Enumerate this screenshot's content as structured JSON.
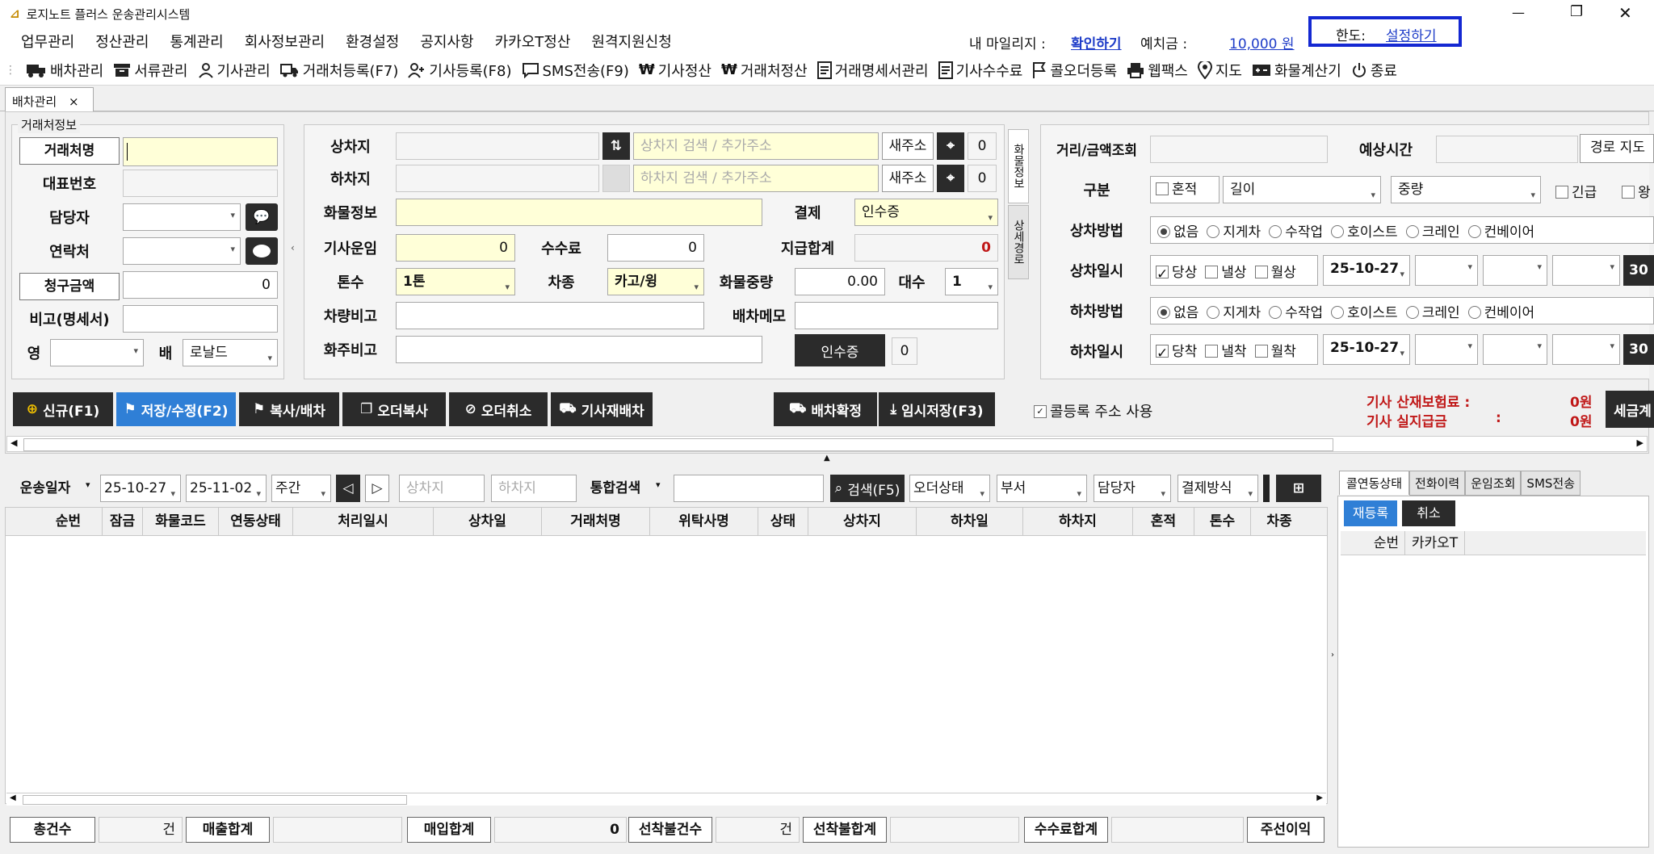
{
  "window": {
    "title": "로지노트 플러스 운송관리시스템",
    "min": "—",
    "max": "❐",
    "close": "✕"
  },
  "menu": [
    "업무관리",
    "정산관리",
    "통계관리",
    "회사정보관리",
    "환경설정",
    "공지사항",
    "카카오T정산",
    "원격지원신청"
  ],
  "header": {
    "mileage_label": "내 마일리지 :",
    "mileage_link": "확인하기",
    "deposit_label": "예치금 :",
    "deposit_value": "10,000 원",
    "limit_label": "한도:",
    "limit_link": "설정하기"
  },
  "toolbar": [
    "배차관리",
    "서류관리",
    "기사관리",
    "거래처등록(F7)",
    "기사등록(F8)",
    "SMS전송(F9)",
    "기사정산",
    "거래처정산",
    "거래명세서관리",
    "기사수수료",
    "콜오더등록",
    "웹팩스",
    "지도",
    "화물계산기",
    "종료"
  ],
  "tab": {
    "label": "배차관리",
    "close": "×"
  },
  "client": {
    "group": "거래처정보",
    "name_btn": "거래처명",
    "repr": "대표번호",
    "manager": "담당자",
    "contact": "연락처",
    "bill_btn": "청구금액",
    "bill_value": "0",
    "memo": "비고(명세서)",
    "young": "영",
    "bae": "배",
    "bae_value": "로날드"
  },
  "route": {
    "load": "상차지",
    "unload": "하차지",
    "load_ph": "상차지 검색 / 추가주소",
    "unload_ph": "하차지 검색 / 추가주소",
    "new_addr": "새주소",
    "load_count": "0",
    "unload_count": "0",
    "side1": "화물정보",
    "side2": "상세경로"
  },
  "cargo": {
    "info": "화물정보",
    "payment": "결제",
    "payment_value": "인수증",
    "fare": "기사운임",
    "fare_value": "0",
    "fee": "수수료",
    "fee_value": "0",
    "pay_total": "지급합계",
    "pay_total_value": "0",
    "ton": "톤수",
    "ton_value": "1톤",
    "car_type": "차종",
    "car_type_value": "카고/윙",
    "weight": "화물중량",
    "weight_value": "0.00",
    "units": "대수",
    "units_value": "1",
    "car_memo": "차량비고",
    "dispatch_memo": "배차메모",
    "owner_memo": "화주비고",
    "receipt_btn": "인수증",
    "receipt_count": "0"
  },
  "dist": {
    "label": "거리/금액조회",
    "est_time": "예상시간",
    "route_map": "경로 지도",
    "kind": "구분",
    "mixed": "혼적",
    "length": "길이",
    "weight": "중량",
    "urgent": "긴급",
    "round": "왕"
  },
  "load_method": {
    "label": "상차방법",
    "options": [
      "없음",
      "지게차",
      "수작업",
      "호이스트",
      "크레인",
      "컨베이어"
    ]
  },
  "load_date": {
    "label": "상차일시",
    "today": "당상",
    "next": "낼상",
    "month": "월상",
    "date": "25-10-27",
    "btn": "30"
  },
  "unload_method": {
    "label": "하차방법",
    "options": [
      "없음",
      "지게차",
      "수작업",
      "호이스트",
      "크레인",
      "컨베이어"
    ]
  },
  "unload_date": {
    "label": "하차일시",
    "today": "당착",
    "next": "낼착",
    "month": "월착",
    "date": "25-10-27",
    "btn": "30"
  },
  "actions": {
    "new": "신규(F1)",
    "save": "저장/수정(F2)",
    "copy_dispatch": "복사/배차",
    "order_copy": "오더복사",
    "order_cancel": "오더취소",
    "redispatch": "기사재배차",
    "confirm": "배차확정",
    "temp_save": "임시저장(F3)",
    "call_addr": "콜등록 주소 사용"
  },
  "insurance": {
    "label1": "기사 산재보험료 :",
    "value1": "0원",
    "label2": "기사 실지급금",
    "colon": ":",
    "value2": "0원",
    "tax_btn": "세금계"
  },
  "filter": {
    "date_label": "운송일자",
    "from": "25-10-27",
    "to": "25-11-02",
    "period": "주간",
    "load_ph": "상차지",
    "unload_ph": "하차지",
    "search_label": "통합검색",
    "search_btn": "검색(F5)",
    "order_status": "오더상태",
    "dept": "부서",
    "manager": "담당자",
    "payment": "결제방식"
  },
  "grid": {
    "columns": [
      "순번",
      "잠금",
      "화물코드",
      "연동상태",
      "처리일시",
      "상차일",
      "거래처명",
      "위탁사명",
      "상태",
      "상차지",
      "하차일",
      "하차지",
      "혼적",
      "톤수",
      "차종"
    ]
  },
  "side_tabs": [
    "콜연동상태",
    "전화이력",
    "운임조회",
    "SMS전송"
  ],
  "side": {
    "reregister": "재등록",
    "cancel": "취소",
    "columns": [
      "순번",
      "카카오T"
    ]
  },
  "footer": {
    "total_count": "총건수",
    "count_unit": "건",
    "sales_total": "매출합계",
    "purchase_total": "매입합계",
    "purchase_value": "0",
    "prepaid_count": "선착불건수",
    "prepaid_unit": "건",
    "prepaid_total": "선착불합계",
    "fee_total": "수수료합계",
    "profit": "주선이익"
  },
  "colors": {
    "highlight_border": "#1428d2",
    "link": "#1e3cc8",
    "alert": "#c01818",
    "dark_btn": "#2b2b2b",
    "blue_btn": "#2f7fd6"
  }
}
